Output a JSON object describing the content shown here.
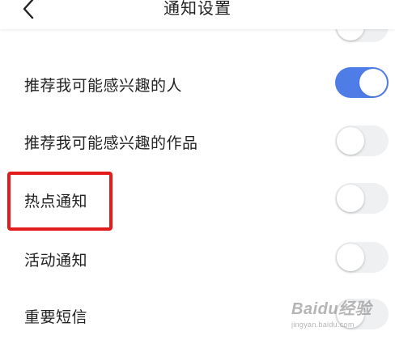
{
  "header": {
    "title": "通知设置",
    "back_icon": "chevron-left-icon"
  },
  "settings": [
    {
      "label": "",
      "enabled": false
    },
    {
      "label": "推荐我可能感兴趣的人",
      "enabled": true
    },
    {
      "label": "推荐我可能感兴趣的作品",
      "enabled": false
    },
    {
      "label": "热点通知",
      "enabled": false
    },
    {
      "label": "活动通知",
      "enabled": false
    },
    {
      "label": "重要短信",
      "enabled": false
    }
  ],
  "colors": {
    "toggle_on": "#4f7de8",
    "toggle_off": "#eef0f2",
    "highlight": "#e31b1b"
  },
  "watermark": {
    "logo": "Baidu经验",
    "url": "jingyan.baidu.com"
  }
}
